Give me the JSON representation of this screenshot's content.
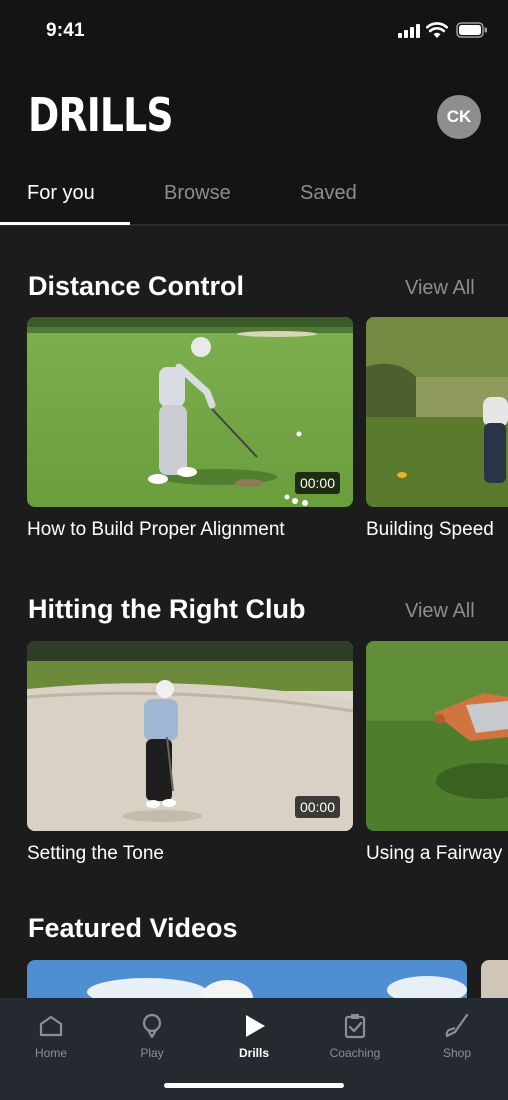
{
  "status_bar": {
    "time": "9:41"
  },
  "header": {
    "title": "DRILLS",
    "avatar_initials": "CK"
  },
  "tabs": [
    {
      "label": "For you",
      "active": true
    },
    {
      "label": "Browse",
      "active": false
    },
    {
      "label": "Saved",
      "active": false
    }
  ],
  "sections": [
    {
      "title": "Distance Control",
      "view_all": "View All",
      "videos": [
        {
          "title": "How to Build Proper Alignment",
          "duration": "00:00"
        },
        {
          "title": "Building Speed"
        }
      ]
    },
    {
      "title": "Hitting the Right Club",
      "view_all": "View All",
      "videos": [
        {
          "title": "Setting the Tone",
          "duration": "00:00"
        },
        {
          "title": "Using a Fairway"
        }
      ]
    },
    {
      "title": "Featured Videos"
    }
  ],
  "bottom_nav": [
    {
      "label": "Home",
      "icon": "home-icon",
      "active": false
    },
    {
      "label": "Play",
      "icon": "pin-icon",
      "active": false
    },
    {
      "label": "Drills",
      "icon": "play-icon",
      "active": true
    },
    {
      "label": "Coaching",
      "icon": "clipboard-icon",
      "active": false
    },
    {
      "label": "Shop",
      "icon": "golf-club-icon",
      "active": false
    }
  ],
  "colors": {
    "background": "#1c1c1c",
    "header": "#141414",
    "nav": "#252a30",
    "muted_text": "#8d8d8d"
  }
}
